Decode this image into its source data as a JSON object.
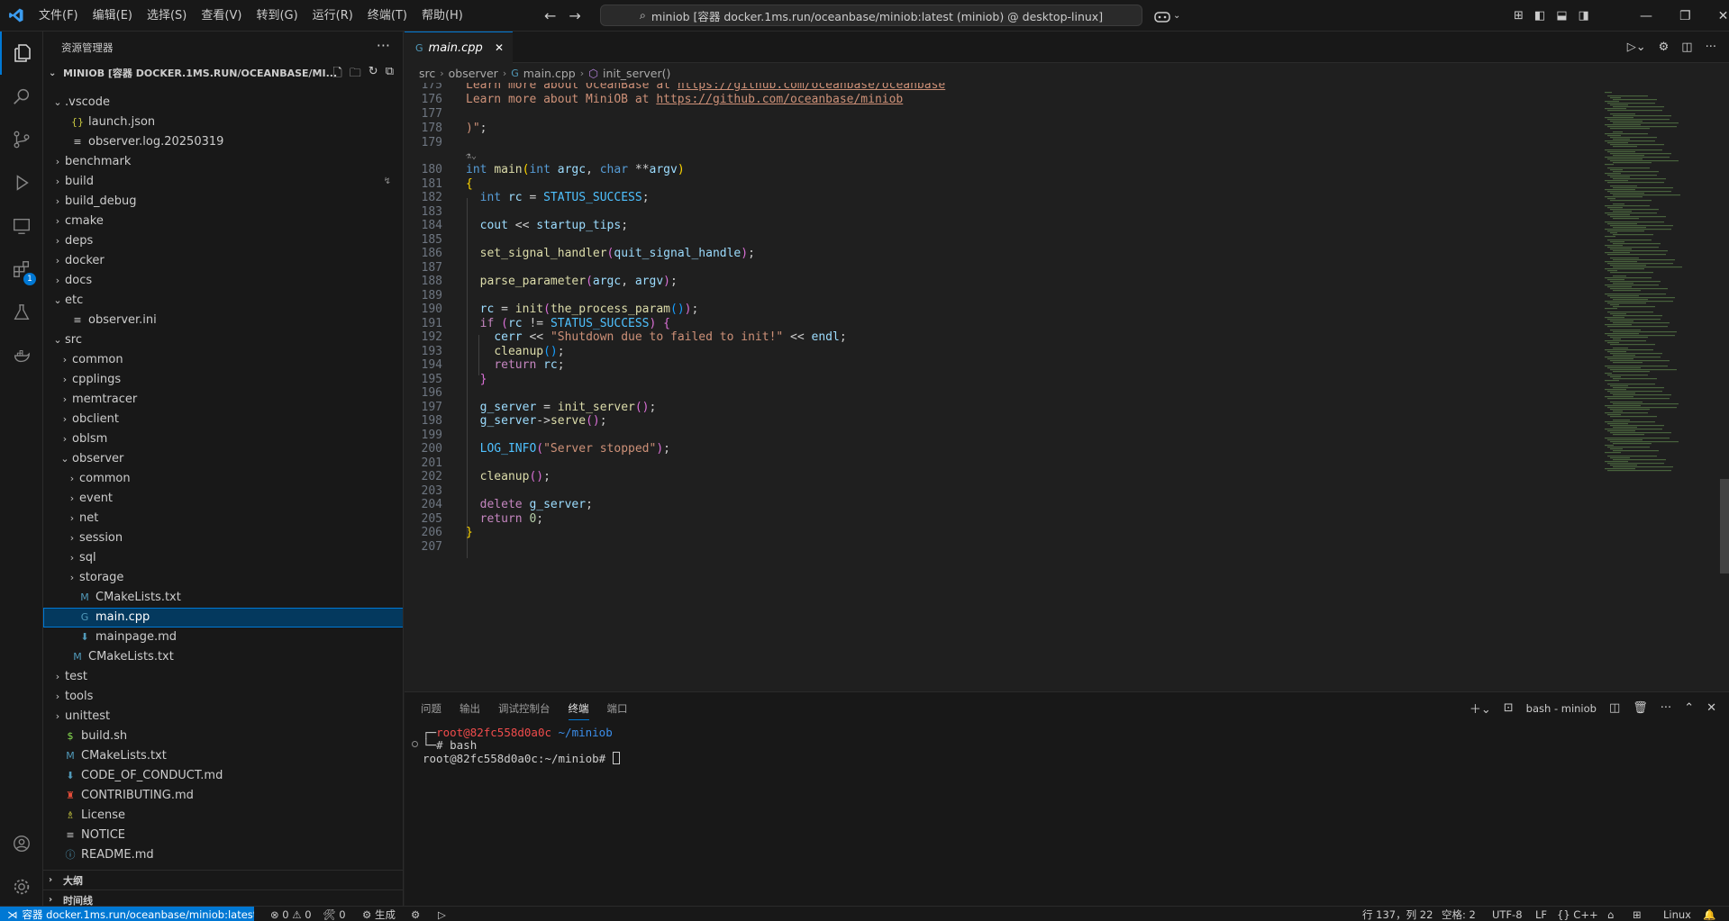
{
  "menu": [
    "文件(F)",
    "编辑(E)",
    "选择(S)",
    "查看(V)",
    "转到(G)",
    "运行(R)",
    "终端(T)",
    "帮助(H)"
  ],
  "command_center": "miniob [容器 docker.1ms.run/oceanbase/miniob:latest (miniob) @ desktop-linux]",
  "sidebar": {
    "title": "资源管理器",
    "project": "MINIOB [容器 DOCKER.1MS.RUN/OCEANBASE/MI...",
    "tree": [
      {
        "label": ".vscode",
        "depth": 1,
        "type": "folder-open"
      },
      {
        "label": "launch.json",
        "depth": 2,
        "type": "json"
      },
      {
        "label": "observer.log.20250319",
        "depth": 2,
        "type": "text"
      },
      {
        "label": "benchmark",
        "depth": 1,
        "type": "folder"
      },
      {
        "label": "build",
        "depth": 1,
        "type": "folder"
      },
      {
        "label": "build_debug",
        "depth": 1,
        "type": "folder"
      },
      {
        "label": "cmake",
        "depth": 1,
        "type": "folder"
      },
      {
        "label": "deps",
        "depth": 1,
        "type": "folder"
      },
      {
        "label": "docker",
        "depth": 1,
        "type": "folder"
      },
      {
        "label": "docs",
        "depth": 1,
        "type": "folder"
      },
      {
        "label": "etc",
        "depth": 1,
        "type": "folder-open"
      },
      {
        "label": "observer.ini",
        "depth": 2,
        "type": "text"
      },
      {
        "label": "src",
        "depth": 1,
        "type": "folder-open"
      },
      {
        "label": "common",
        "depth": 2,
        "type": "folder"
      },
      {
        "label": "cpplings",
        "depth": 2,
        "type": "folder"
      },
      {
        "label": "memtracer",
        "depth": 2,
        "type": "folder"
      },
      {
        "label": "obclient",
        "depth": 2,
        "type": "folder"
      },
      {
        "label": "oblsm",
        "depth": 2,
        "type": "folder"
      },
      {
        "label": "observer",
        "depth": 2,
        "type": "folder-open"
      },
      {
        "label": "common",
        "depth": 3,
        "type": "folder"
      },
      {
        "label": "event",
        "depth": 3,
        "type": "folder"
      },
      {
        "label": "net",
        "depth": 3,
        "type": "folder"
      },
      {
        "label": "session",
        "depth": 3,
        "type": "folder"
      },
      {
        "label": "sql",
        "depth": 3,
        "type": "folder"
      },
      {
        "label": "storage",
        "depth": 3,
        "type": "folder"
      },
      {
        "label": "CMakeLists.txt",
        "depth": 3,
        "type": "cmake"
      },
      {
        "label": "main.cpp",
        "depth": 3,
        "type": "cpp"
      },
      {
        "label": "mainpage.md",
        "depth": 3,
        "type": "md"
      },
      {
        "label": "CMakeLists.txt",
        "depth": 2,
        "type": "cmake"
      },
      {
        "label": "test",
        "depth": 1,
        "type": "folder"
      },
      {
        "label": "tools",
        "depth": 1,
        "type": "folder"
      },
      {
        "label": "unittest",
        "depth": 1,
        "type": "folder"
      },
      {
        "label": "build.sh",
        "depth": 1,
        "type": "shell"
      },
      {
        "label": "CMakeLists.txt",
        "depth": 1,
        "type": "cmake"
      },
      {
        "label": "CODE_OF_CONDUCT.md",
        "depth": 1,
        "type": "md"
      },
      {
        "label": "CONTRIBUTING.md",
        "depth": 1,
        "type": "contrib"
      },
      {
        "label": "License",
        "depth": 1,
        "type": "license"
      },
      {
        "label": "NOTICE",
        "depth": 1,
        "type": "text"
      },
      {
        "label": "README.md",
        "depth": 1,
        "type": "info"
      }
    ],
    "outline": "大纲",
    "timeline": "时间线"
  },
  "editor": {
    "tab_label": "main.cpp",
    "breadcrumb": [
      "src",
      "observer",
      "main.cpp",
      "init_server()"
    ]
  },
  "panel": {
    "tabs": [
      "问题",
      "输出",
      "调试控制台",
      "终端",
      "端口"
    ],
    "active_tab": "终端",
    "terminal_name": "bash - miniob",
    "prompt_user": "root@82fc558d0a0c",
    "prompt_dir": "~/miniob",
    "shell_line": "# bash",
    "prompt_line": "root@82fc558d0a0c:~/miniob#"
  },
  "statusbar": {
    "remote": "容器 docker.1ms.run/oceanbase/miniob:latest",
    "problems": "⊗ 0 ⚠ 0",
    "ports": "🛠 0",
    "build": "生成",
    "cursor": "行 137，列 22",
    "spaces": "空格: 2",
    "encoding": "UTF-8",
    "eol": "LF",
    "language": "C++",
    "platform": "Linux"
  },
  "colors": {
    "accent": "#0078d4",
    "background": "#1f1f1f",
    "sidebar_bg": "#181818"
  }
}
